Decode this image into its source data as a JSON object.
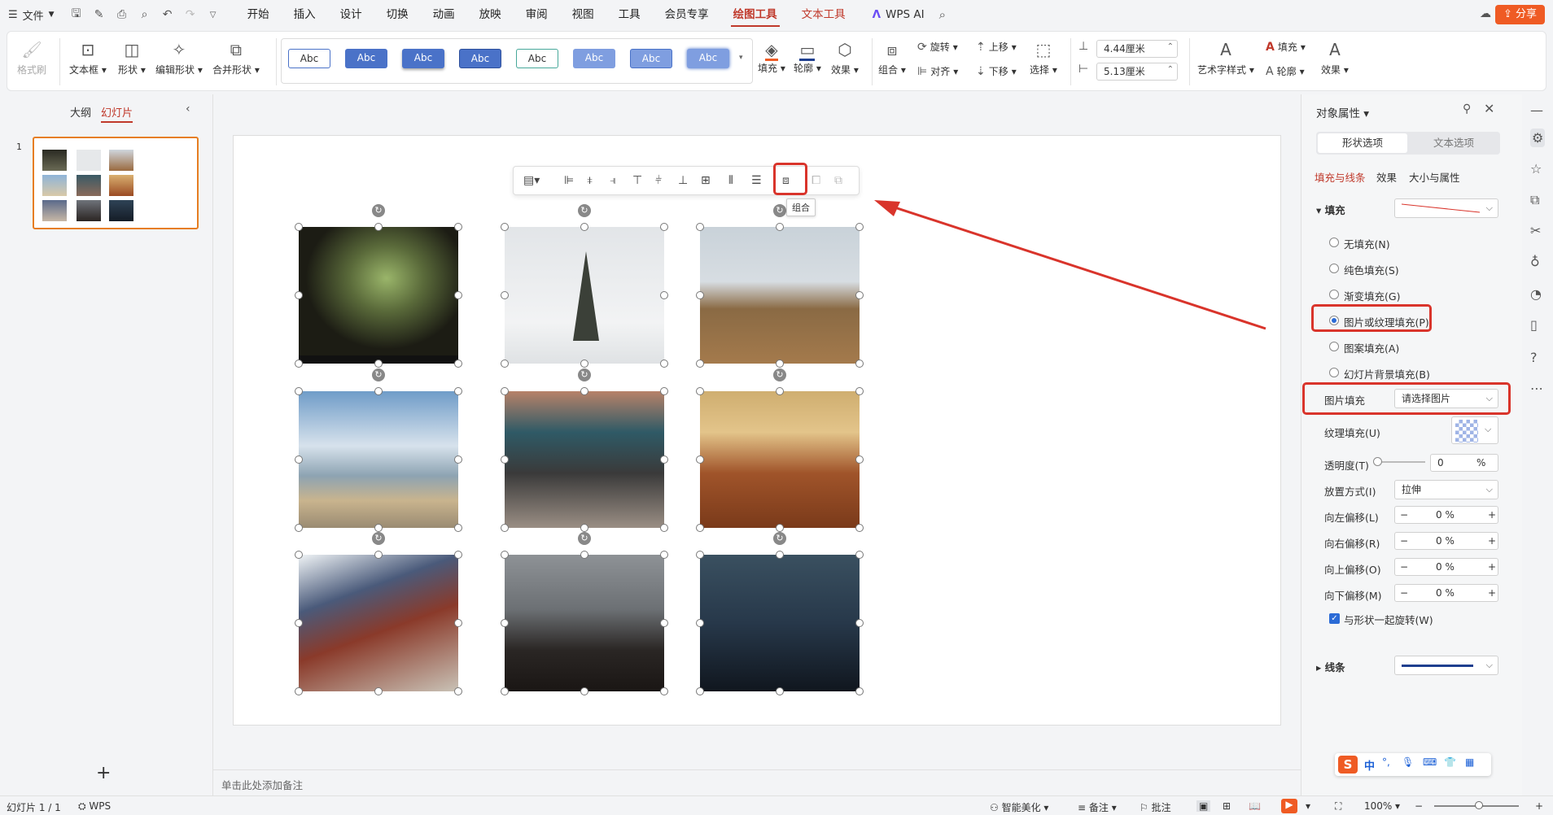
{
  "menubar": {
    "file_label": "文件",
    "tabs": [
      "开始",
      "插入",
      "设计",
      "切换",
      "动画",
      "放映",
      "审阅",
      "视图",
      "工具",
      "会员专享",
      "绘图工具",
      "文本工具"
    ],
    "wps_ai": "WPS AI",
    "share": "分享"
  },
  "ribbon": {
    "format_painter": "格式刷",
    "textbox": "文本框",
    "shape": "形状",
    "edit_shape": "编辑形状",
    "merge_shape": "合并形状",
    "style_sample": "Abc",
    "fill": "填充",
    "outline": "轮廓",
    "effect": "效果",
    "group": "组合",
    "rotate": "旋转",
    "align": "对齐",
    "bring_forward": "上移",
    "send_backward": "下移",
    "select": "选择",
    "height": "4.44厘米",
    "width": "5.13厘米",
    "art_style": "艺术字样式",
    "text_fill": "填充",
    "text_outline": "轮廓",
    "text_effect": "效果"
  },
  "left_panel": {
    "tab_outline": "大纲",
    "tab_slides": "幻灯片",
    "slide_number": "1",
    "add": "+"
  },
  "canvas": {
    "tooltip": "组合"
  },
  "notes_placeholder": "单击此处添加备注",
  "right_panel": {
    "title": "对象属性",
    "tab_shape": "形状选项",
    "tab_text": "文本选项",
    "sub_fill_line": "填充与线条",
    "sub_effect": "效果",
    "sub_size": "大小与属性",
    "fill_section": "填充",
    "opt_none": "无填充(N)",
    "opt_solid": "纯色填充(S)",
    "opt_gradient": "渐变填充(G)",
    "opt_picture": "图片或纹理填充(P)",
    "opt_pattern": "图案填充(A)",
    "opt_bg": "幻灯片背景填充(B)",
    "picture_fill_label": "图片填充",
    "picture_fill_value": "请选择图片",
    "texture_fill": "纹理填充(U)",
    "transparency_label": "透明度(T)",
    "transparency_value": "0",
    "percent": "%",
    "placement_label": "放置方式(I)",
    "placement_value": "拉伸",
    "offset_left": "向左偏移(L)",
    "offset_right": "向右偏移(R)",
    "offset_top": "向上偏移(O)",
    "offset_bottom": "向下偏移(M)",
    "offset_value": "0 %",
    "rotate_with_shape": "与形状一起旋转(W)",
    "line_section": "线条"
  },
  "ime": {
    "lang": "中"
  },
  "statusbar": {
    "slide_info": "幻灯片 1 / 1",
    "wps": "WPS",
    "beautify": "智能美化",
    "notes": "备注",
    "comment": "批注",
    "zoom": "100%"
  },
  "colors": {
    "accent": "#c0392b",
    "highlight_box": "#d9342b",
    "share": "#ef5b24",
    "style_blue": "#4a72c8"
  }
}
